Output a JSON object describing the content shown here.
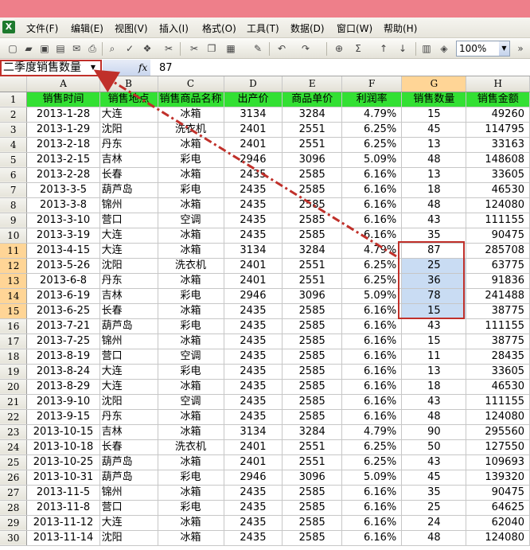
{
  "menu": {
    "items": [
      "文件(F)",
      "编辑(E)",
      "视图(V)",
      "插入(I)",
      "格式(O)",
      "工具(T)",
      "数据(D)",
      "窗口(W)",
      "帮助(H)"
    ]
  },
  "toolbar": {
    "zoom": "100%",
    "icons": [
      "new-icon",
      "open-icon",
      "save-icon",
      "permission-icon",
      "email-icon",
      "print-icon",
      "print-preview-icon",
      "spelling-icon",
      "research-icon",
      "cut-icon",
      "copy-icon",
      "paste-icon",
      "format-painter-icon",
      "undo-icon",
      "redo-icon",
      "hyperlink-icon",
      "autosum-icon",
      "sort-asc-icon",
      "sort-desc-icon",
      "chart-icon",
      "drawing-icon"
    ]
  },
  "formula_bar": {
    "name_box": "二季度销售数量",
    "fx": "fx",
    "value": "87"
  },
  "columns": [
    "A",
    "B",
    "C",
    "D",
    "E",
    "F",
    "G",
    "H"
  ],
  "headers": [
    "销售时间",
    "销售地点",
    "销售商品名称",
    "出产价",
    "商品单价",
    "利润率",
    "销售数量",
    "销售金额"
  ],
  "rows": [
    [
      "2013-1-28",
      "大连",
      "冰箱",
      "3134",
      "3284",
      "4.79%",
      "15",
      "49260"
    ],
    [
      "2013-1-29",
      "沈阳",
      "洗衣机",
      "2401",
      "2551",
      "6.25%",
      "45",
      "114795"
    ],
    [
      "2013-2-18",
      "丹东",
      "冰箱",
      "2401",
      "2551",
      "6.25%",
      "13",
      "33163"
    ],
    [
      "2013-2-15",
      "吉林",
      "彩电",
      "2946",
      "3096",
      "5.09%",
      "48",
      "148608"
    ],
    [
      "2013-2-28",
      "长春",
      "冰箱",
      "2435",
      "2585",
      "6.16%",
      "13",
      "33605"
    ],
    [
      "2013-3-5",
      "葫芦岛",
      "彩电",
      "2435",
      "2585",
      "6.16%",
      "18",
      "46530"
    ],
    [
      "2013-3-8",
      "锦州",
      "冰箱",
      "2435",
      "2585",
      "6.16%",
      "48",
      "124080"
    ],
    [
      "2013-3-10",
      "营口",
      "空调",
      "2435",
      "2585",
      "6.16%",
      "43",
      "111155"
    ],
    [
      "2013-3-19",
      "大连",
      "冰箱",
      "2435",
      "2585",
      "6.16%",
      "35",
      "90475"
    ],
    [
      "2013-4-15",
      "大连",
      "冰箱",
      "3134",
      "3284",
      "4.79%",
      "87",
      "285708"
    ],
    [
      "2013-5-26",
      "沈阳",
      "洗衣机",
      "2401",
      "2551",
      "6.25%",
      "25",
      "63775"
    ],
    [
      "2013-6-8",
      "丹东",
      "冰箱",
      "2401",
      "2551",
      "6.25%",
      "36",
      "91836"
    ],
    [
      "2013-6-19",
      "吉林",
      "彩电",
      "2946",
      "3096",
      "5.09%",
      "78",
      "241488"
    ],
    [
      "2013-6-25",
      "长春",
      "冰箱",
      "2435",
      "2585",
      "6.16%",
      "15",
      "38775"
    ],
    [
      "2013-7-21",
      "葫芦岛",
      "彩电",
      "2435",
      "2585",
      "6.16%",
      "43",
      "111155"
    ],
    [
      "2013-7-25",
      "锦州",
      "冰箱",
      "2435",
      "2585",
      "6.16%",
      "15",
      "38775"
    ],
    [
      "2013-8-19",
      "营口",
      "空调",
      "2435",
      "2585",
      "6.16%",
      "11",
      "28435"
    ],
    [
      "2013-8-24",
      "大连",
      "彩电",
      "2435",
      "2585",
      "6.16%",
      "13",
      "33605"
    ],
    [
      "2013-8-29",
      "大连",
      "冰箱",
      "2435",
      "2585",
      "6.16%",
      "18",
      "46530"
    ],
    [
      "2013-9-10",
      "沈阳",
      "空调",
      "2435",
      "2585",
      "6.16%",
      "43",
      "111155"
    ],
    [
      "2013-9-15",
      "丹东",
      "冰箱",
      "2435",
      "2585",
      "6.16%",
      "48",
      "124080"
    ],
    [
      "2013-10-15",
      "吉林",
      "冰箱",
      "3134",
      "3284",
      "4.79%",
      "90",
      "295560"
    ],
    [
      "2013-10-18",
      "长春",
      "洗衣机",
      "2401",
      "2551",
      "6.25%",
      "50",
      "127550"
    ],
    [
      "2013-10-25",
      "葫芦岛",
      "冰箱",
      "2401",
      "2551",
      "6.25%",
      "43",
      "109693"
    ],
    [
      "2013-10-31",
      "葫芦岛",
      "彩电",
      "2946",
      "3096",
      "5.09%",
      "45",
      "139320"
    ],
    [
      "2013-11-5",
      "锦州",
      "冰箱",
      "2435",
      "2585",
      "6.16%",
      "35",
      "90475"
    ],
    [
      "2013-11-8",
      "营口",
      "彩电",
      "2435",
      "2585",
      "6.16%",
      "25",
      "64625"
    ],
    [
      "2013-11-12",
      "大连",
      "冰箱",
      "2435",
      "2585",
      "6.16%",
      "24",
      "62040"
    ],
    [
      "2013-11-14",
      "沈阳",
      "冰箱",
      "2435",
      "2585",
      "6.16%",
      "48",
      "124080"
    ]
  ],
  "selection": {
    "column": "G",
    "first_row": 11,
    "last_row": 15,
    "active_row": 11
  },
  "colors": {
    "header_fill": "#33e033",
    "selection_fill": "#c9dcf3",
    "highlight_header": "#ffd596",
    "annotation_red": "#c0302a",
    "titlebar": "#ee7f8a"
  }
}
